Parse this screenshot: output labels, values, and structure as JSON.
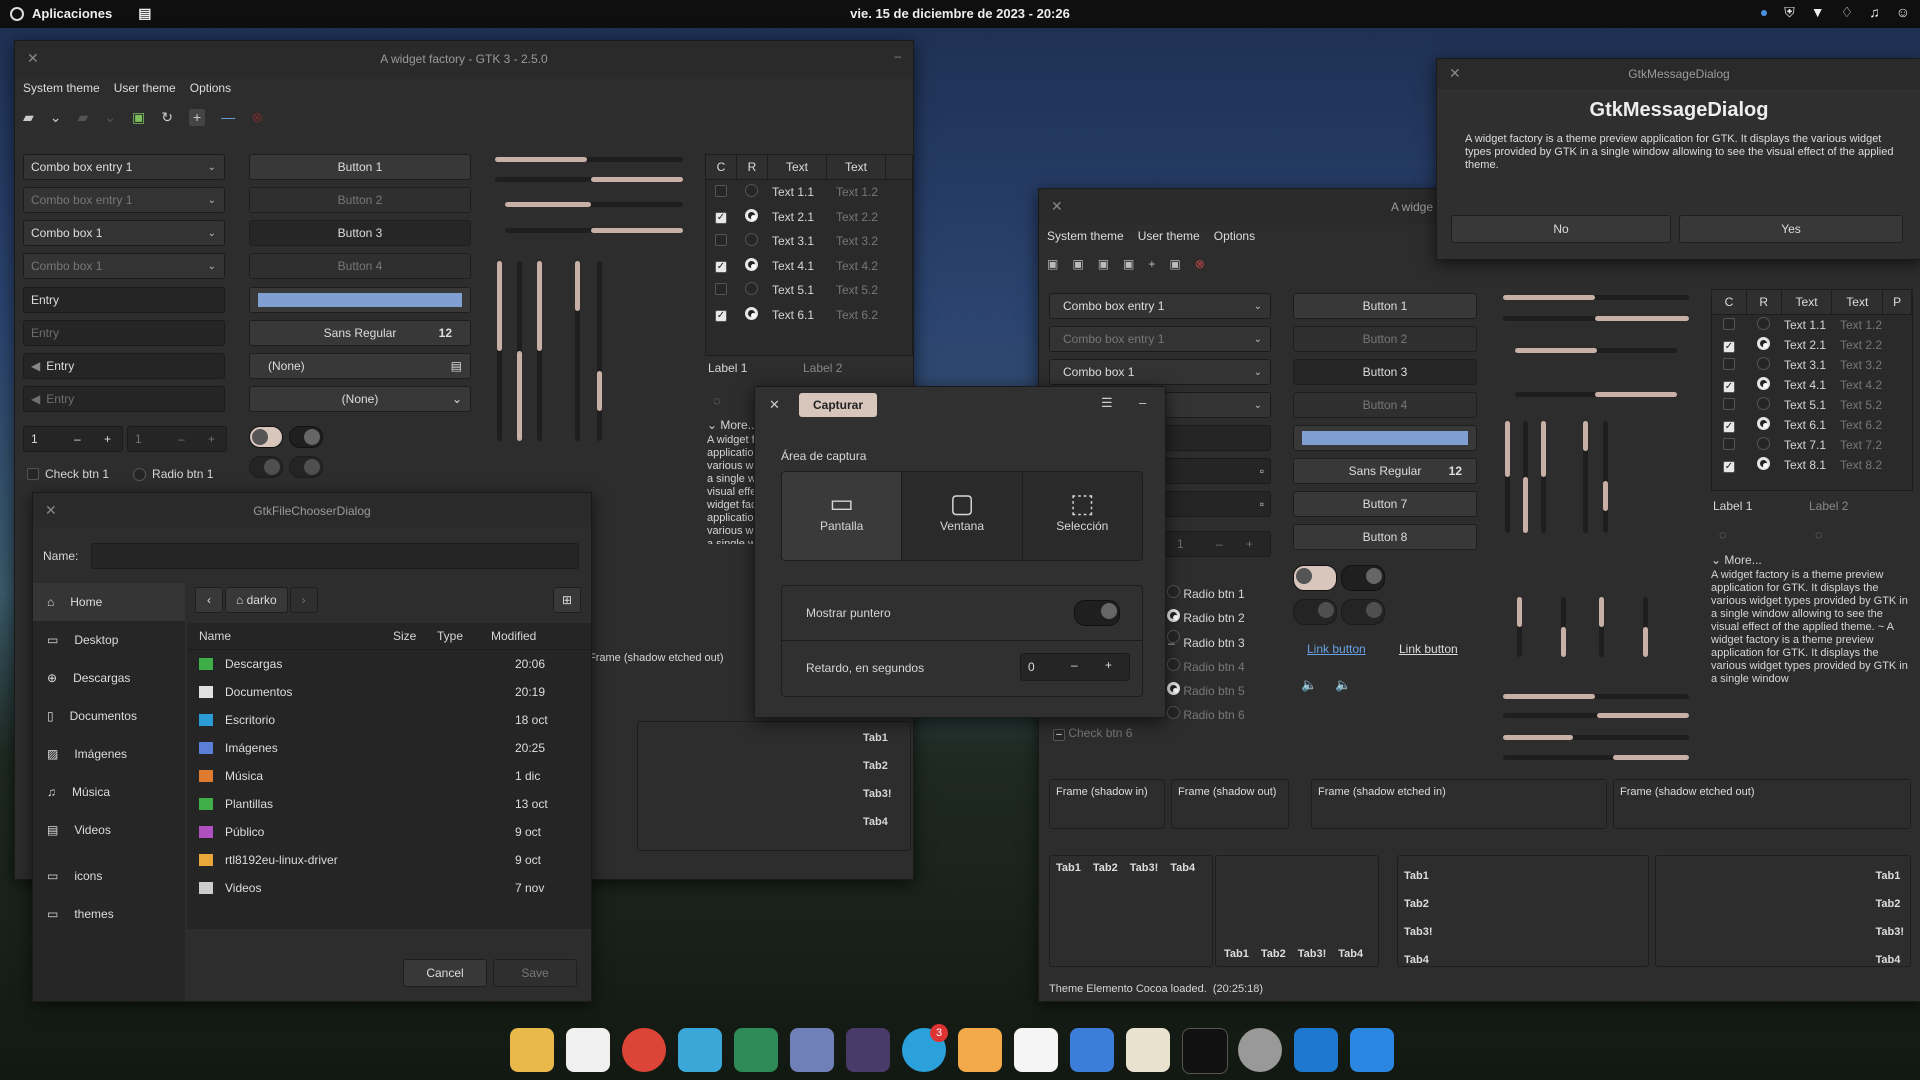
{
  "topbar": {
    "apps_label": "Aplicaciones",
    "datetime": "vie. 15 de diciembre de 2023 - 20:26"
  },
  "wf1": {
    "title": "A widget factory - GTK 3 - 2.5.0",
    "menu": [
      "System theme",
      "User theme",
      "Options"
    ],
    "combo_entry_1": "Combo box entry 1",
    "combo_entry_1_dim": "Combo box entry 1",
    "combo_box_1": "Combo box 1",
    "combo_box_1_dim": "Combo box 1",
    "entry": "Entry",
    "entry_placeholder": "Entry",
    "entry_icon": "Entry",
    "entry_icon_dim": "Entry",
    "spin1": "1",
    "spin2": "1",
    "check_btn_1": "Check btn 1",
    "radio_btn_1": "Radio btn 1",
    "buttons": [
      "Button 1",
      "Button 2",
      "Button 3",
      "Button 4"
    ],
    "font_name": "Sans Regular",
    "font_size": "12",
    "file_none": "(None)",
    "combo_none": "(None)",
    "tv_headers": [
      "C",
      "R",
      "Text",
      "Text"
    ],
    "tv_rows": [
      {
        "t1": "Text 1.1",
        "t2": "Text 1.2"
      },
      {
        "t1": "Text 2.1",
        "t2": "Text 2.2"
      },
      {
        "t1": "Text 3.1",
        "t2": "Text 3.2"
      },
      {
        "t1": "Text 4.1",
        "t2": "Text 4.2"
      },
      {
        "t1": "Text 5.1",
        "t2": "Text 5.2"
      },
      {
        "t1": "Text 6.1",
        "t2": "Text 6.2"
      }
    ],
    "label1": "Label 1",
    "label2": "Label 2",
    "more": "More...",
    "more_text": "A widget factory is a theme preview application for GTK. It displays the various widget types provided by GTK in a single window allowing to see the visual effect of the applied theme. ~ A widget factory is a theme preview application for GTK. It displays the various widget types provided by GTK in a single window",
    "frame_etched_out": "Frame (shadow etched out)",
    "tabs": [
      "Tab1",
      "Tab2",
      "Tab3!",
      "Tab4"
    ]
  },
  "capture": {
    "title": "Capturar",
    "area_label": "Área de captura",
    "modes": [
      "Pantalla",
      "Ventana",
      "Selección"
    ],
    "show_pointer": "Mostrar puntero",
    "delay_label": "Retardo, en segundos",
    "delay_value": "0"
  },
  "msg": {
    "window_title": "GtkMessageDialog",
    "heading": "GtkMessageDialog",
    "body": "A widget factory is a theme preview application for GTK. It displays the various widget types provided by GTK in a single window allowing to see the visual effect of the applied theme.",
    "no": "No",
    "yes": "Yes"
  },
  "wf2": {
    "title": "A widge",
    "menu": [
      "System theme",
      "User theme",
      "Options"
    ],
    "combo_entry_1": "Combo box entry 1",
    "combo_entry_1_dim": "Combo box entry 1",
    "combo_box_1": "Combo box 1",
    "spin": "1",
    "buttons": [
      "Button 1",
      "Button 2",
      "Button 3",
      "Button 4"
    ],
    "font_name": "Sans Regular",
    "font_size": "12",
    "button7": "Button 7",
    "button8": "Button 8",
    "radios": [
      "Radio btn 1",
      "Radio btn 2",
      "Radio btn 3",
      "Radio btn 4",
      "Radio btn 5",
      "Radio btn 6"
    ],
    "check6": "Check btn 6",
    "link1": "Link button",
    "link2": "Link button",
    "tv_headers": [
      "C",
      "R",
      "Text",
      "Text",
      "P"
    ],
    "tv_rows": [
      {
        "t1": "Text 1.1",
        "t2": "Text 1.2"
      },
      {
        "t1": "Text 2.1",
        "t2": "Text 2.2"
      },
      {
        "t1": "Text 3.1",
        "t2": "Text 3.2"
      },
      {
        "t1": "Text 4.1",
        "t2": "Text 4.2"
      },
      {
        "t1": "Text 5.1",
        "t2": "Text 5.2"
      },
      {
        "t1": "Text 6.1",
        "t2": "Text 6.2"
      },
      {
        "t1": "Text 7.1",
        "t2": "Text 7.2"
      },
      {
        "t1": "Text 8.1",
        "t2": "Text 8.2"
      }
    ],
    "label1": "Label 1",
    "label2": "Label 2",
    "more": "More...",
    "more_text": "A widget factory is a theme preview application for GTK. It displays the various widget types provided by GTK in a single window allowing to see the visual effect of the applied theme. ~ A widget factory is a theme preview application for GTK. It displays the various widget types provided by GTK in a single window",
    "frames": [
      "Frame (shadow in)",
      "Frame (shadow out)",
      "Frame (shadow etched in)",
      "Frame (shadow etched out)"
    ],
    "tabs": [
      "Tab1",
      "Tab2",
      "Tab3!",
      "Tab4"
    ],
    "status": "Theme Elemento Cocoa loaded.",
    "status_time": "(20:25:18)"
  },
  "fc": {
    "title": "GtkFileChooserDialog",
    "name_label": "Name:",
    "sidebar": [
      {
        "label": "Home",
        "icon": "home-icon"
      },
      {
        "label": "Desktop",
        "icon": "desktop-icon"
      },
      {
        "label": "Descargas",
        "icon": "download-icon"
      },
      {
        "label": "Documentos",
        "icon": "document-icon"
      },
      {
        "label": "Imágenes",
        "icon": "image-icon"
      },
      {
        "label": "Música",
        "icon": "music-icon"
      },
      {
        "label": "Videos",
        "icon": "video-icon"
      },
      {
        "label": "icons",
        "icon": "folder-icon"
      },
      {
        "label": "themes",
        "icon": "folder-icon"
      }
    ],
    "path": "darko",
    "columns": [
      "Name",
      "Size",
      "Type",
      "Modified"
    ],
    "files": [
      {
        "name": "Descargas",
        "modified": "20:06",
        "color": "#3fae49"
      },
      {
        "name": "Documentos",
        "modified": "20:19",
        "color": "#e0e0e0"
      },
      {
        "name": "Escritorio",
        "modified": "18 oct",
        "color": "#2b9bd6"
      },
      {
        "name": "Imágenes",
        "modified": "20:25",
        "color": "#5b7fd6"
      },
      {
        "name": "Música",
        "modified": "1 dic",
        "color": "#e07a2e"
      },
      {
        "name": "Plantillas",
        "modified": "13 oct",
        "color": "#3fae49"
      },
      {
        "name": "Público",
        "modified": "9 oct",
        "color": "#b04fc0"
      },
      {
        "name": "rtl8192eu-linux-driver",
        "modified": "9 oct",
        "color": "#e8a73a"
      },
      {
        "name": "Videos",
        "modified": "7 nov",
        "color": "#cccccc"
      }
    ],
    "cancel": "Cancel",
    "save": "Save"
  },
  "dock": {
    "badge": "3",
    "items": [
      "files-icon",
      "store-icon",
      "chrome-icon",
      "screenshot-icon",
      "spreadsheet-icon",
      "photos-icon",
      "video-icon",
      "telegram-icon",
      "mail-icon",
      "calendar-icon",
      "contacts-icon",
      "text-editor-icon",
      "terminal-icon",
      "settings-icon",
      "vscode-icon",
      "vscode-alt-icon"
    ]
  }
}
